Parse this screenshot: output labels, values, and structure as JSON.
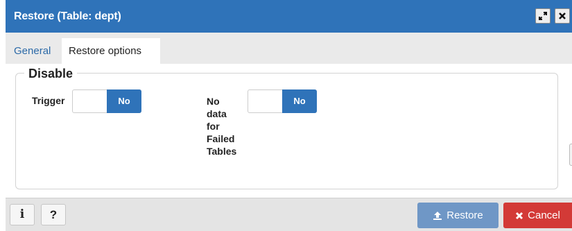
{
  "dialog": {
    "title": "Restore (Table: dept)"
  },
  "tabs": [
    {
      "label": "General",
      "active": false
    },
    {
      "label": "Restore options",
      "active": true
    }
  ],
  "disable_section": {
    "legend": "Disable",
    "trigger": {
      "label": "Trigger",
      "value": "No"
    },
    "no_data_failed_tables": {
      "label_lines": [
        "No",
        "data",
        "for",
        "Failed",
        "Tables"
      ],
      "value": "No"
    }
  },
  "footer": {
    "info_label": "i",
    "help_label": "?",
    "restore_label": "Restore",
    "cancel_label": "Cancel"
  },
  "colors": {
    "titlebar": "#2f73b9",
    "toggle_off": "#2f73b9",
    "restore_button": "#6f97c6",
    "cancel_button": "#d33a37"
  },
  "icons": {
    "maximize": "expand-arrows-icon",
    "close": "close-x-icon",
    "restore": "upload-icon",
    "cancel": "x-icon"
  }
}
